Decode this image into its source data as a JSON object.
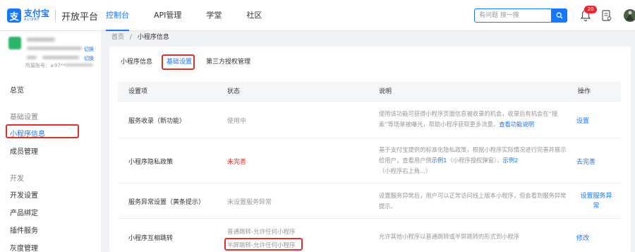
{
  "brand": {
    "logo_glyph": "支",
    "name_cn": "支付宝",
    "name_en": "ALIPAY",
    "product": "开放平台",
    "accent": "#1677ff"
  },
  "nav": [
    {
      "label": "控制台",
      "active": true
    },
    {
      "label": "API管理"
    },
    {
      "label": "学堂"
    },
    {
      "label": "社区"
    }
  ],
  "search": {
    "placeholder": "有问题 搜一搜"
  },
  "header": {
    "notification_count": "20"
  },
  "app": {
    "link1": "切换",
    "link2": "切换",
    "id_prefix": "所属账号：±97**"
  },
  "sidebar": {
    "overview": "总览",
    "group_basic": "基础设置",
    "item_info": "小程序信息",
    "item_members": "成员管理",
    "group_dev": "开发",
    "item_dev_settings": "开发设置",
    "item_product_bind": "产品绑定",
    "item_plugin": "插件服务",
    "item_gray": "灰度管理"
  },
  "breadcrumb": {
    "home": "首页",
    "sep": "/",
    "current": "小程序信息"
  },
  "tabs": [
    {
      "label": "小程序信息"
    },
    {
      "label": "基础设置",
      "active": true
    },
    {
      "label": "第三方授权管理"
    }
  ],
  "table": {
    "headers": [
      "设置项",
      "状态",
      "说明",
      "操作"
    ],
    "rows": [
      {
        "item": "服务收录（新功能）",
        "status": "使用中",
        "desc": "使用该功能可获得小程序页面信息被收录的机会，收录后有机会在“搜索”等场景被曝光，帮助小程序获取更多流量。",
        "desc_link": "查看功能说明",
        "action": "设置"
      },
      {
        "item": "小程序隐私政策",
        "status": "未完善",
        "desc_pre": "基于支付宝提供的标准化隐私政策，根据小程序实际情况进行完善并展示给用户，查看用户侧",
        "link1": "示例1",
        "mid": "（小程序授权弹窗）、",
        "link2": "示例2",
        "desc_post": "（小程序右上角...）",
        "action": "去完善"
      },
      {
        "item": "服务异常设置（黄条提示）",
        "status": "未设置服务异常",
        "desc": "设置服务异常后，用户可以正常访问线上版本小程序，但会看到服务异常提示。",
        "action": "设置服务异常"
      },
      {
        "item": "小程序互相跳转",
        "status1": "普通跳转-允许任何小程序",
        "status2": "半屏跳转-允许任何小程序",
        "desc": "允许其他小程序以普通跳转或半屏跳转的形式到小程序",
        "action": "修改"
      }
    ]
  }
}
